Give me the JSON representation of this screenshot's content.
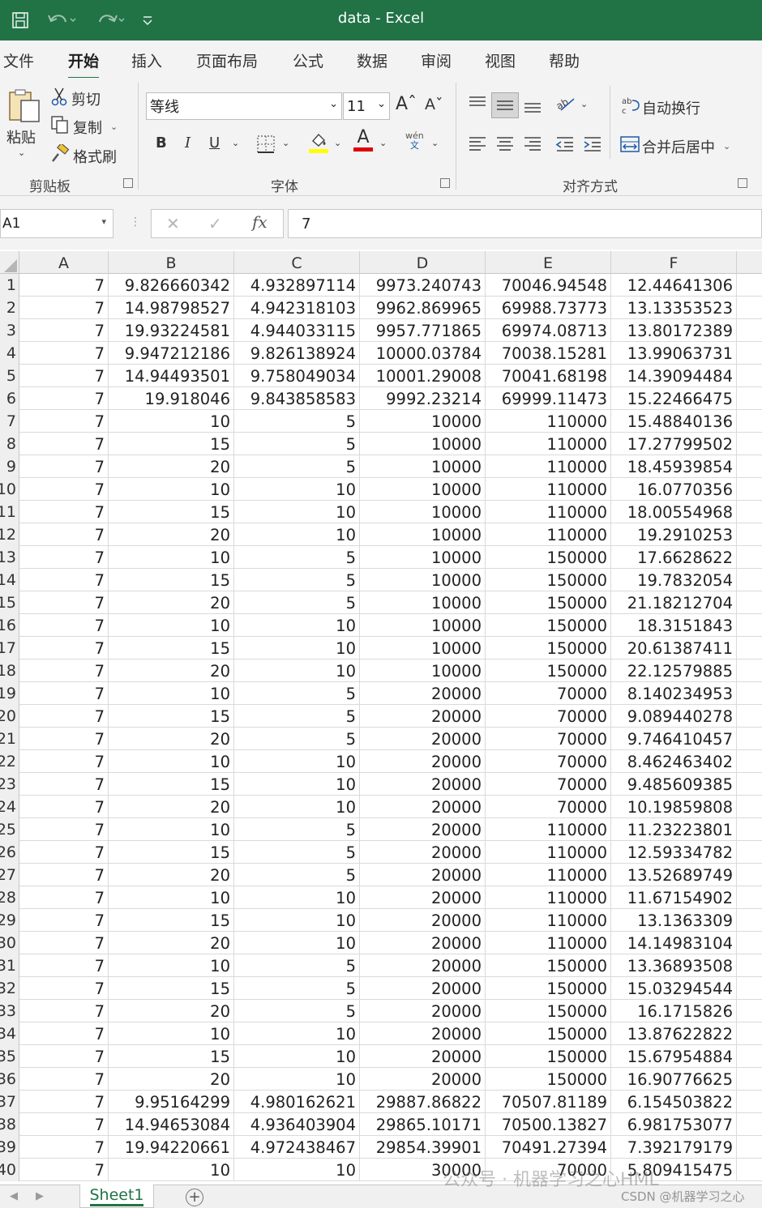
{
  "window": {
    "title": "data  -  Excel",
    "accent_color": "#217346"
  },
  "menu": {
    "tabs": [
      "文件",
      "开始",
      "插入",
      "页面布局",
      "公式",
      "数据",
      "审阅",
      "视图",
      "帮助"
    ],
    "active_index": 1
  },
  "ribbon": {
    "clipboard": {
      "paste": "粘贴",
      "cut": "剪切",
      "copy": "复制",
      "format_painter": "格式刷",
      "label": "剪贴板"
    },
    "font": {
      "name": "等线",
      "size": "11",
      "bold": "B",
      "italic": "I",
      "underline": "U",
      "font_color_letter": "A",
      "phonetic_top": "wén",
      "phonetic_bottom": "文",
      "label": "字体",
      "fill_color": "#ffff00",
      "font_color": "#e00000"
    },
    "alignment": {
      "wrap_text": "自动换行",
      "merge_center": "合并后居中",
      "label": "对齐方式"
    }
  },
  "formula_bar": {
    "name_box": "A1",
    "fx": "fx",
    "value": "7"
  },
  "sheet": {
    "columns": [
      "A",
      "B",
      "C",
      "D",
      "E",
      "F"
    ],
    "row_numbers": [
      "1",
      "2",
      "3",
      "4",
      "5",
      "6",
      "7",
      "8",
      "9",
      "10",
      "11",
      "12",
      "13",
      "14",
      "15",
      "16",
      "17",
      "18",
      "19",
      "20",
      "21",
      "22",
      "23",
      "24",
      "25",
      "26",
      "27",
      "28",
      "29",
      "30",
      "31",
      "32",
      "33",
      "34",
      "35",
      "36",
      "37",
      "38",
      "39",
      "40"
    ],
    "rows": [
      [
        "7",
        "9.826660342",
        "4.932897114",
        "9973.240743",
        "70046.94548",
        "12.44641306"
      ],
      [
        "7",
        "14.98798527",
        "4.942318103",
        "9962.869965",
        "69988.73773",
        "13.13353523"
      ],
      [
        "7",
        "19.93224581",
        "4.944033115",
        "9957.771865",
        "69974.08713",
        "13.80172389"
      ],
      [
        "7",
        "9.947212186",
        "9.826138924",
        "10000.03784",
        "70038.15281",
        "13.99063731"
      ],
      [
        "7",
        "14.94493501",
        "9.758049034",
        "10001.29008",
        "70041.68198",
        "14.39094484"
      ],
      [
        "7",
        "19.918046",
        "9.843858583",
        "9992.23214",
        "69999.11473",
        "15.22466475"
      ],
      [
        "7",
        "10",
        "5",
        "10000",
        "110000",
        "15.48840136"
      ],
      [
        "7",
        "15",
        "5",
        "10000",
        "110000",
        "17.27799502"
      ],
      [
        "7",
        "20",
        "5",
        "10000",
        "110000",
        "18.45939854"
      ],
      [
        "7",
        "10",
        "10",
        "10000",
        "110000",
        "16.0770356"
      ],
      [
        "7",
        "15",
        "10",
        "10000",
        "110000",
        "18.00554968"
      ],
      [
        "7",
        "20",
        "10",
        "10000",
        "110000",
        "19.2910253"
      ],
      [
        "7",
        "10",
        "5",
        "10000",
        "150000",
        "17.6628622"
      ],
      [
        "7",
        "15",
        "5",
        "10000",
        "150000",
        "19.7832054"
      ],
      [
        "7",
        "20",
        "5",
        "10000",
        "150000",
        "21.18212704"
      ],
      [
        "7",
        "10",
        "10",
        "10000",
        "150000",
        "18.3151843"
      ],
      [
        "7",
        "15",
        "10",
        "10000",
        "150000",
        "20.61387411"
      ],
      [
        "7",
        "20",
        "10",
        "10000",
        "150000",
        "22.12579885"
      ],
      [
        "7",
        "10",
        "5",
        "20000",
        "70000",
        "8.140234953"
      ],
      [
        "7",
        "15",
        "5",
        "20000",
        "70000",
        "9.089440278"
      ],
      [
        "7",
        "20",
        "5",
        "20000",
        "70000",
        "9.746410457"
      ],
      [
        "7",
        "10",
        "10",
        "20000",
        "70000",
        "8.462463402"
      ],
      [
        "7",
        "15",
        "10",
        "20000",
        "70000",
        "9.485609385"
      ],
      [
        "7",
        "20",
        "10",
        "20000",
        "70000",
        "10.19859808"
      ],
      [
        "7",
        "10",
        "5",
        "20000",
        "110000",
        "11.23223801"
      ],
      [
        "7",
        "15",
        "5",
        "20000",
        "110000",
        "12.59334782"
      ],
      [
        "7",
        "20",
        "5",
        "20000",
        "110000",
        "13.52689749"
      ],
      [
        "7",
        "10",
        "10",
        "20000",
        "110000",
        "11.67154902"
      ],
      [
        "7",
        "15",
        "10",
        "20000",
        "110000",
        "13.1363309"
      ],
      [
        "7",
        "20",
        "10",
        "20000",
        "110000",
        "14.14983104"
      ],
      [
        "7",
        "10",
        "5",
        "20000",
        "150000",
        "13.36893508"
      ],
      [
        "7",
        "15",
        "5",
        "20000",
        "150000",
        "15.03294544"
      ],
      [
        "7",
        "20",
        "5",
        "20000",
        "150000",
        "16.1715826"
      ],
      [
        "7",
        "10",
        "10",
        "20000",
        "150000",
        "13.87622822"
      ],
      [
        "7",
        "15",
        "10",
        "20000",
        "150000",
        "15.67954884"
      ],
      [
        "7",
        "20",
        "10",
        "20000",
        "150000",
        "16.90776625"
      ],
      [
        "7",
        "9.95164299",
        "4.980162621",
        "29887.86822",
        "70507.81189",
        "6.154503822"
      ],
      [
        "7",
        "14.94653084",
        "4.936403904",
        "29865.10171",
        "70500.13827",
        "6.981753077"
      ],
      [
        "7",
        "19.94220661",
        "4.972438467",
        "29854.39901",
        "70491.27394",
        "7.392179179"
      ],
      [
        "7",
        "10",
        "10",
        "30000",
        "70000",
        "5.809415475"
      ]
    ],
    "tab_name": "Sheet1"
  },
  "watermark": {
    "line1": "公众号 · 机器学习之心HML",
    "line2": "CSDN @机器学习之心"
  }
}
